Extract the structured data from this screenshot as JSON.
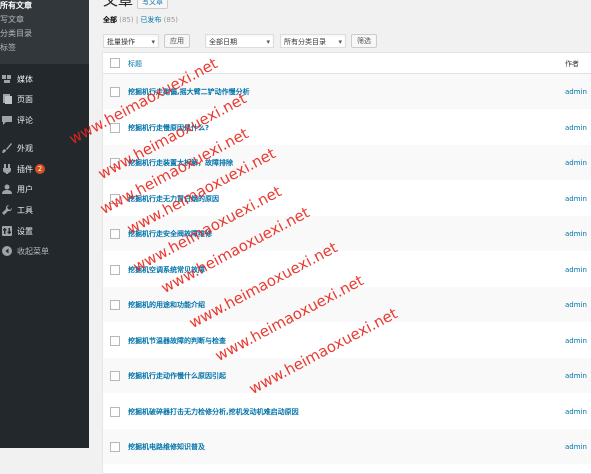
{
  "sidebar": {
    "submenu": [
      {
        "label": "所有文章",
        "current": true
      },
      {
        "label": "写文章"
      },
      {
        "label": "分类目录"
      },
      {
        "label": "标签"
      }
    ],
    "menu": [
      {
        "label": "媒体",
        "icon": "media-icon"
      },
      {
        "label": "页面",
        "icon": "page-icon"
      },
      {
        "label": "评论",
        "icon": "comment-icon"
      },
      {
        "label": "外观",
        "icon": "brush-icon"
      },
      {
        "label": "插件",
        "icon": "plugin-icon",
        "badge": "2"
      },
      {
        "label": "用户",
        "icon": "user-icon"
      },
      {
        "label": "工具",
        "icon": "wrench-icon"
      },
      {
        "label": "设置",
        "icon": "settings-icon"
      },
      {
        "label": "收起菜单",
        "icon": "collapse-icon"
      }
    ]
  },
  "header": {
    "title": "文章",
    "add_new": "写文章"
  },
  "filters": {
    "all_label": "全部",
    "all_count": "(85)",
    "separator": "|",
    "published_label": "已发布",
    "published_count": "(85)"
  },
  "toolbar": {
    "bulk_actions": "批量操作",
    "apply": "应用",
    "dates": "全部日期",
    "categories": "所有分类目录",
    "filter": "筛选"
  },
  "table": {
    "col_title": "标题",
    "col_author": "作者",
    "rows": [
      {
        "title": "挖掘机行走跑偏,摇大臂二铲动作慢分析",
        "author": "admin"
      },
      {
        "title": "挖掘机行走慢原因是什么?",
        "author": "admin"
      },
      {
        "title": "挖掘机行走装置大拆解，故障排除",
        "author": "admin"
      },
      {
        "title": "挖掘机行走无力冒白烟的原因",
        "author": "admin"
      },
      {
        "title": "挖掘机行走安全阀故障维修",
        "author": "admin"
      },
      {
        "title": "挖掘机空调系统常见故障",
        "author": "admin"
      },
      {
        "title": "挖掘机的用途和功能介绍",
        "author": "admin"
      },
      {
        "title": "挖掘机节温器故障的判断与检查",
        "author": "admin"
      },
      {
        "title": "挖掘机行走动作慢什么原因引起",
        "author": "admin"
      },
      {
        "title": "挖掘机破碎器打击无力检修分析,挖机发动机难启动原因",
        "author": "admin"
      },
      {
        "title": "挖掘机电路维修知识普及",
        "author": "admin"
      }
    ]
  },
  "watermark": "www.heimaoxuexi.net",
  "colors": {
    "sidebar_bg": "#23282d",
    "submenu_bg": "#32373c",
    "link": "#0073aa",
    "badge": "#d54e21",
    "watermark": "#e8261c"
  }
}
